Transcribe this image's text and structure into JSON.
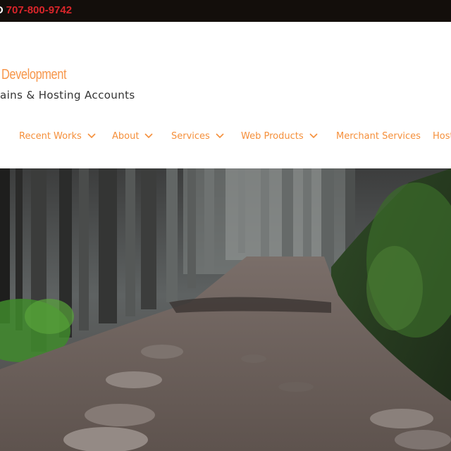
{
  "topbar": {
    "phone_prefix": "O",
    "phone_number": "707-800-9742"
  },
  "header": {
    "site_title": "Development",
    "tagline": "ains & Hosting Accounts"
  },
  "nav": {
    "items": [
      {
        "label": "Recent Works",
        "has_dropdown": true
      },
      {
        "label": "About",
        "has_dropdown": true
      },
      {
        "label": "Services",
        "has_dropdown": true
      },
      {
        "label": "Web Products",
        "has_dropdown": true
      },
      {
        "label": "Merchant Services",
        "has_dropdown": false
      },
      {
        "label": "Host",
        "has_dropdown": false
      }
    ]
  },
  "colors": {
    "topbar_bg": "#130e0b",
    "phone": "#d9252a",
    "accent": "#f58f3a",
    "tagline": "#333333"
  },
  "hero": {
    "image": "forest-path-photo"
  }
}
